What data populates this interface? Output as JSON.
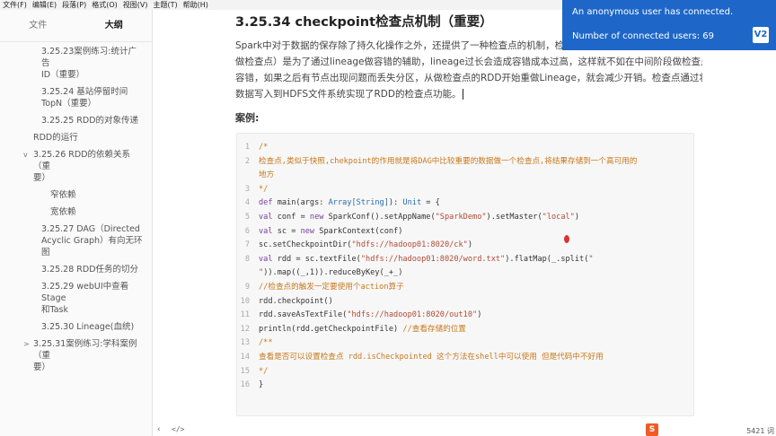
{
  "menu": [
    "文件(F)",
    "编辑(E)",
    "段落(P)",
    "格式(O)",
    "视图(V)",
    "主题(T)",
    "帮助(H)"
  ],
  "sidebar": {
    "tabs": [
      "文件",
      "大纲"
    ],
    "active_tab": "大纲",
    "outline": [
      {
        "level": 2,
        "lines": [
          "3.25.23案例练习:统计广告",
          "ID（重要）"
        ]
      },
      {
        "level": 2,
        "lines": [
          "3.25.24 基站停留时间",
          "TopN（重要）"
        ]
      },
      {
        "level": 2,
        "lines": [
          "3.25.25 RDD的对象传递"
        ]
      },
      {
        "level": 1,
        "lines": [
          "RDD的运行"
        ]
      },
      {
        "level": 1,
        "arrow": "v",
        "lines": [
          "3.25.26 RDD的依赖关系（重",
          "要）"
        ]
      },
      {
        "level": 3,
        "lines": [
          "窄依赖"
        ]
      },
      {
        "level": 3,
        "lines": [
          "宽依赖"
        ]
      },
      {
        "level": 2,
        "lines": [
          "3.25.27 DAG（Directed",
          "Acyclic Graph）有向无环图"
        ]
      },
      {
        "level": 2,
        "lines": [
          "3.25.28 RDD任务的切分"
        ]
      },
      {
        "level": 2,
        "lines": [
          "3.25.29 webUI中查看Stage",
          "和Task"
        ]
      },
      {
        "level": 2,
        "lines": [
          "3.25.30 Lineage(血统)"
        ]
      },
      {
        "level": 1,
        "arrow": ">",
        "lines": [
          "3.25.31案例练习:学科案例（重",
          "要）"
        ]
      }
    ]
  },
  "main": {
    "heading": "3.25.34 checkpoint检查点机制（重要）",
    "paragraph": [
      "Spark中对于数据的保存除了持久化操作之外，还提供了一种检查点的机制，检查",
      "做检查点）是为了通过lineage做容错的辅助，lineage过长会造成容错成本过高，这样就不如在中间阶段做检查点",
      "容错，如果之后有节点出现问题而丢失分区，从做检查点的RDD开始重做Lineage，就会减少开销。检查点通过将",
      "数据写入到HDFS文件系统实现了RDD的检查点功能。"
    ],
    "case_label": "案例:",
    "code_lines": [
      {
        "n": "1",
        "parts": [
          {
            "c": "cm",
            "t": "/*"
          }
        ]
      },
      {
        "n": "2",
        "parts": [
          {
            "c": "cm",
            "t": "    检查点,类似于快照,chekpoint的作用就是将DAG中比较重要的数据做一个检查点,将结果存储到一个高可用的"
          }
        ]
      },
      {
        "n": "",
        "parts": [
          {
            "c": "cm",
            "t": "地方"
          }
        ]
      },
      {
        "n": "3",
        "parts": [
          {
            "c": "cm",
            "t": "     */"
          }
        ]
      },
      {
        "n": "4",
        "parts": [
          {
            "c": "kw",
            "t": "def "
          },
          {
            "c": "fn",
            "t": "main(args: "
          },
          {
            "c": "ty",
            "t": "Array[String]"
          },
          {
            "c": "fn",
            "t": "): "
          },
          {
            "c": "ty",
            "t": "Unit"
          },
          {
            "c": "fn",
            "t": " = {"
          }
        ]
      },
      {
        "n": "5",
        "parts": [
          {
            "c": "kw",
            "t": "    val "
          },
          {
            "c": "fn",
            "t": "conf = "
          },
          {
            "c": "kw",
            "t": "new "
          },
          {
            "c": "fn",
            "t": "SparkConf().setAppName("
          },
          {
            "c": "st",
            "t": "\"SparkDemo\""
          },
          {
            "c": "fn",
            "t": ").setMaster("
          },
          {
            "c": "st",
            "t": "\"local\""
          },
          {
            "c": "fn",
            "t": ")"
          }
        ]
      },
      {
        "n": "6",
        "parts": [
          {
            "c": "kw",
            "t": "    val "
          },
          {
            "c": "fn",
            "t": "sc = "
          },
          {
            "c": "kw",
            "t": "new "
          },
          {
            "c": "fn",
            "t": "SparkContext(conf)"
          }
        ]
      },
      {
        "n": "7",
        "parts": [
          {
            "c": "fn",
            "t": "    sc.setCheckpointDir("
          },
          {
            "c": "st",
            "t": "\"hdfs://hadoop01:8020/ck\""
          },
          {
            "c": "fn",
            "t": ")"
          }
        ]
      },
      {
        "n": "8",
        "parts": [
          {
            "c": "kw",
            "t": "    val "
          },
          {
            "c": "fn",
            "t": "rdd =  sc.textFile("
          },
          {
            "c": "st",
            "t": "\"hdfs://hadoop01:8020/word.txt\""
          },
          {
            "c": "fn",
            "t": ").flatMap(_.split("
          },
          {
            "c": "st",
            "t": "\""
          }
        ]
      },
      {
        "n": "",
        "parts": [
          {
            "c": "st",
            "t": "\""
          },
          {
            "c": "fn",
            "t": ")).map((_,1)).reduceByKey(_+_)"
          }
        ]
      },
      {
        "n": "9",
        "parts": [
          {
            "c": "cm",
            "t": "    //检查点的触发一定要使用个action算子"
          }
        ]
      },
      {
        "n": "10",
        "parts": [
          {
            "c": "fn",
            "t": "    rdd.checkpoint()"
          }
        ]
      },
      {
        "n": "11",
        "parts": [
          {
            "c": "fn",
            "t": "    rdd.saveAsTextFile("
          },
          {
            "c": "st",
            "t": "\"hdfs://hadoop01:8020/out10\""
          },
          {
            "c": "fn",
            "t": ")"
          }
        ]
      },
      {
        "n": "12",
        "parts": [
          {
            "c": "fn",
            "t": "    println(rdd.getCheckpointFile) "
          },
          {
            "c": "cm",
            "t": "//查看存储的位置"
          }
        ]
      },
      {
        "n": "13",
        "parts": [
          {
            "c": "cm",
            "t": "    /**"
          }
        ]
      },
      {
        "n": "14",
        "parts": [
          {
            "c": "cm",
            "t": "    查看是否可以设置检查点   rdd.isCheckpointed  这个方法在shell中可以使用 但是代码中不好用"
          }
        ]
      },
      {
        "n": "15",
        "parts": [
          {
            "c": "cm",
            "t": "     */"
          }
        ]
      },
      {
        "n": "16",
        "parts": [
          {
            "c": "fn",
            "t": "}"
          }
        ]
      }
    ]
  },
  "bottombar": {
    "back": "‹",
    "source": "</>",
    "sogou": "S",
    "word_count": "5421 词"
  },
  "notification": {
    "line1": "An anonymous user has connected.",
    "line2": "Number of connected users: 69",
    "badge": "V2"
  }
}
